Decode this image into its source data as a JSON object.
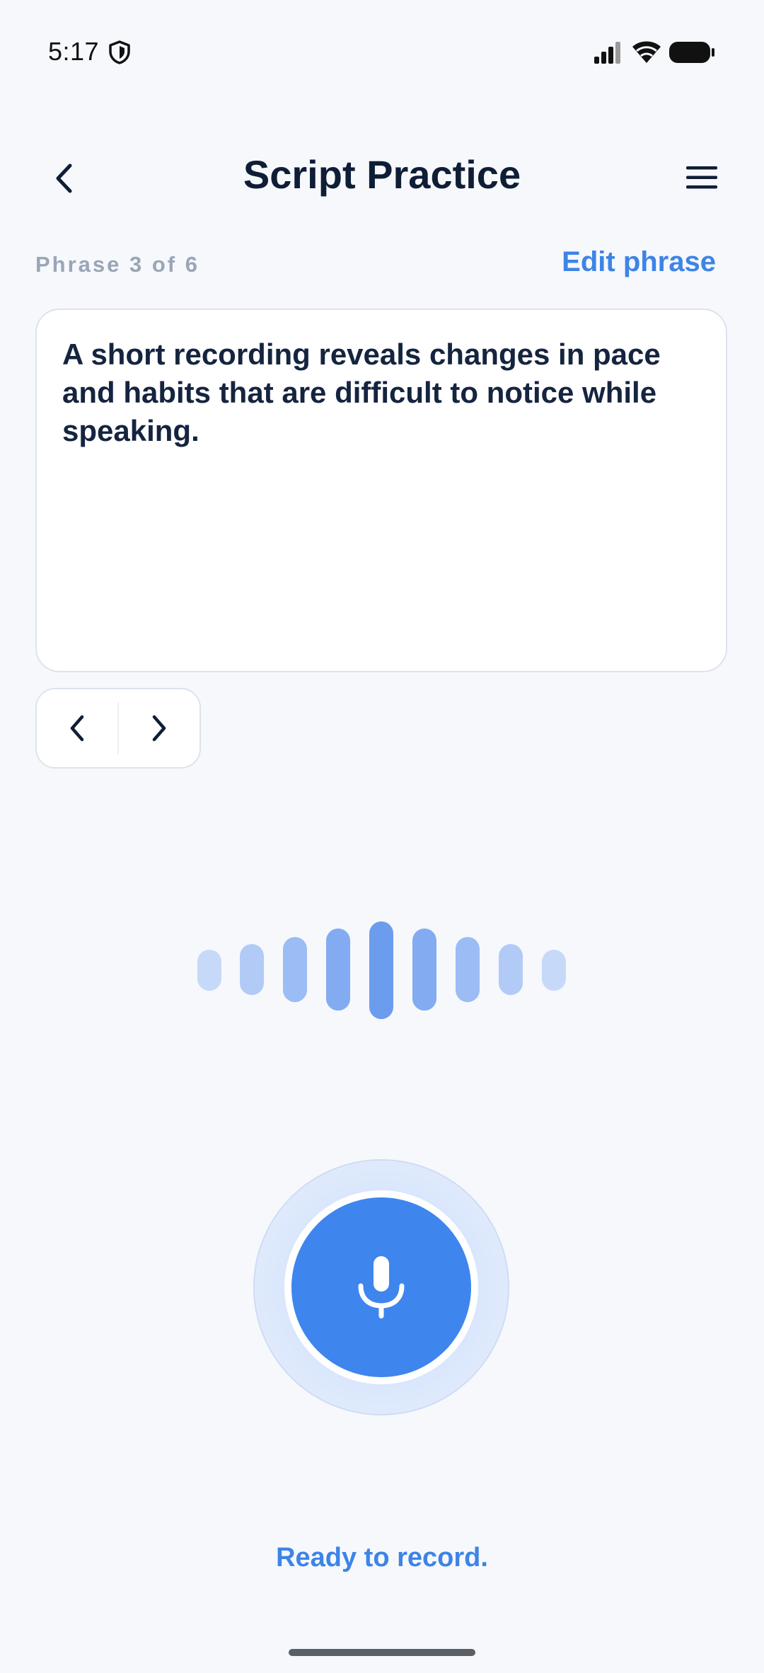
{
  "status_bar": {
    "time": "5:17",
    "icons": [
      "shield-icon",
      "signal-icon",
      "wifi-icon",
      "battery-icon"
    ]
  },
  "header": {
    "title": "Script Practice",
    "back_icon": "chevron-left-icon",
    "menu_icon": "hamburger-menu-icon"
  },
  "phrase": {
    "counter": "Phrase 3 of 6",
    "edit_label": "Edit phrase",
    "text": "A short recording reveals changes in pace and habits that are difficult to notice while speaking."
  },
  "pager": {
    "prev_icon": "chevron-left-icon",
    "next_icon": "chevron-right-icon"
  },
  "recorder": {
    "mic_icon": "microphone-icon",
    "status": "Ready to record."
  },
  "colors": {
    "accent": "#3e85ee",
    "link": "#3d84e6",
    "title": "#0f1e36",
    "muted": "#9aa5b6",
    "background": "#f6f8fc"
  }
}
